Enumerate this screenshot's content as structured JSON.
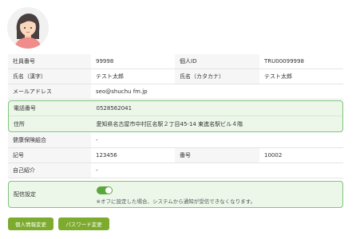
{
  "profile": {
    "employee_number_label": "社員番号",
    "employee_number": "99998",
    "personal_id_label": "個人ID",
    "personal_id": "TRU00099998",
    "name_kanji_label": "氏名（漢字）",
    "name_kanji": "テスト太郎",
    "name_kana_label": "氏名（カタカナ）",
    "name_kana": "テスト太郎",
    "email_label": "メールアドレス",
    "email": "seo@shuchu fm.jp",
    "phone_label": "電話番号",
    "phone": "0528562041",
    "address_label": "住所",
    "address": "愛知県名古屋市中村区名駅２丁目45-14 東進名駅ビル４階",
    "insurance_label": "健康保険組合",
    "insurance": "-",
    "symbol_label": "記号",
    "symbol": "123456",
    "number_label": "番号",
    "number": "10002",
    "intro_label": "自己紹介",
    "intro": "-",
    "delivery_label": "配信設定",
    "delivery_enabled": true,
    "delivery_note": "※オフに設定した場合、システムから通知が受信できなくなります。"
  },
  "buttons": {
    "edit_profile": "個人情報変更",
    "change_password": "パスワード変更"
  },
  "colors": {
    "accent": "#7cab2e",
    "highlight_border": "#7fc47b",
    "highlight_bg": "#ecf7ea"
  }
}
